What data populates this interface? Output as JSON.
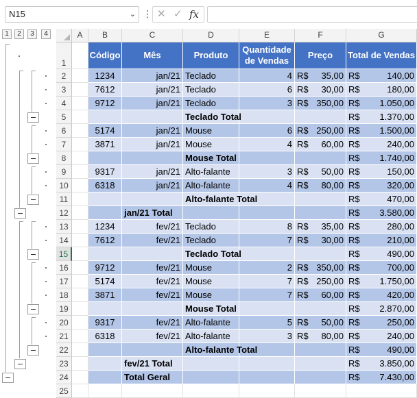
{
  "name_box": {
    "value": "N15"
  },
  "formula_bar": {
    "value": ""
  },
  "outline_levels": [
    "1",
    "2",
    "3",
    "4"
  ],
  "columns": [
    "A",
    "B",
    "C",
    "D",
    "E",
    "F",
    "G"
  ],
  "headers": {
    "codigo": "Código",
    "mes": "Mês",
    "produto": "Produto",
    "quantidade": "Quantidade de Vendas",
    "preco": "Preço",
    "total": "Total de Vendas"
  },
  "currency": "R$",
  "rows": [
    {
      "n": "1",
      "type": "header"
    },
    {
      "n": "2",
      "type": "data",
      "codigo": "1234",
      "mes": "jan/21",
      "produto": "Teclado",
      "qtd": "4",
      "preco": "35,00",
      "total": "140,00"
    },
    {
      "n": "3",
      "type": "data",
      "codigo": "7612",
      "mes": "jan/21",
      "produto": "Teclado",
      "qtd": "6",
      "preco": "30,00",
      "total": "180,00"
    },
    {
      "n": "4",
      "type": "data",
      "codigo": "9712",
      "mes": "jan/21",
      "produto": "Teclado",
      "qtd": "3",
      "preco": "350,00",
      "total": "1.050,00"
    },
    {
      "n": "5",
      "type": "sub",
      "label": "Teclado Total",
      "total": "1.370,00"
    },
    {
      "n": "6",
      "type": "data",
      "codigo": "5174",
      "mes": "jan/21",
      "produto": "Mouse",
      "qtd": "6",
      "preco": "250,00",
      "total": "1.500,00"
    },
    {
      "n": "7",
      "type": "data",
      "codigo": "3871",
      "mes": "jan/21",
      "produto": "Mouse",
      "qtd": "4",
      "preco": "60,00",
      "total": "240,00"
    },
    {
      "n": "8",
      "type": "sub",
      "label": "Mouse Total",
      "total": "1.740,00"
    },
    {
      "n": "9",
      "type": "data",
      "codigo": "9317",
      "mes": "jan/21",
      "produto": "Alto-falante",
      "qtd": "3",
      "preco": "50,00",
      "total": "150,00"
    },
    {
      "n": "10",
      "type": "data",
      "codigo": "6318",
      "mes": "jan/21",
      "produto": "Alto-falante",
      "qtd": "4",
      "preco": "80,00",
      "total": "320,00"
    },
    {
      "n": "11",
      "type": "sub",
      "label": "Alto-falante Total",
      "total": "470,00"
    },
    {
      "n": "12",
      "type": "month",
      "label": "jan/21 Total",
      "total": "3.580,00"
    },
    {
      "n": "13",
      "type": "data",
      "codigo": "1234",
      "mes": "fev/21",
      "produto": "Teclado",
      "qtd": "8",
      "preco": "35,00",
      "total": "280,00"
    },
    {
      "n": "14",
      "type": "data",
      "codigo": "7612",
      "mes": "fev/21",
      "produto": "Teclado",
      "qtd": "7",
      "preco": "30,00",
      "total": "210,00"
    },
    {
      "n": "15",
      "type": "sub",
      "label": "Teclado Total",
      "total": "490,00"
    },
    {
      "n": "16",
      "type": "data",
      "codigo": "9712",
      "mes": "fev/21",
      "produto": "Mouse",
      "qtd": "2",
      "preco": "350,00",
      "total": "700,00"
    },
    {
      "n": "17",
      "type": "data",
      "codigo": "5174",
      "mes": "fev/21",
      "produto": "Mouse",
      "qtd": "7",
      "preco": "250,00",
      "total": "1.750,00"
    },
    {
      "n": "18",
      "type": "data",
      "codigo": "3871",
      "mes": "fev/21",
      "produto": "Mouse",
      "qtd": "7",
      "preco": "60,00",
      "total": "420,00"
    },
    {
      "n": "19",
      "type": "sub",
      "label": "Mouse Total",
      "total": "2.870,00"
    },
    {
      "n": "20",
      "type": "data",
      "codigo": "9317",
      "mes": "fev/21",
      "produto": "Alto-falante",
      "qtd": "5",
      "preco": "50,00",
      "total": "250,00"
    },
    {
      "n": "21",
      "type": "data",
      "codigo": "6318",
      "mes": "fev/21",
      "produto": "Alto-falante",
      "qtd": "3",
      "preco": "80,00",
      "total": "240,00"
    },
    {
      "n": "22",
      "type": "sub",
      "label": "Alto-falante Total",
      "total": "490,00"
    },
    {
      "n": "23",
      "type": "month",
      "label": "fev/21 Total",
      "total": "3.850,00"
    },
    {
      "n": "24",
      "type": "month",
      "label": "Total Geral",
      "total": "7.430,00"
    },
    {
      "n": "25",
      "type": "empty"
    }
  ],
  "active_row": "15"
}
